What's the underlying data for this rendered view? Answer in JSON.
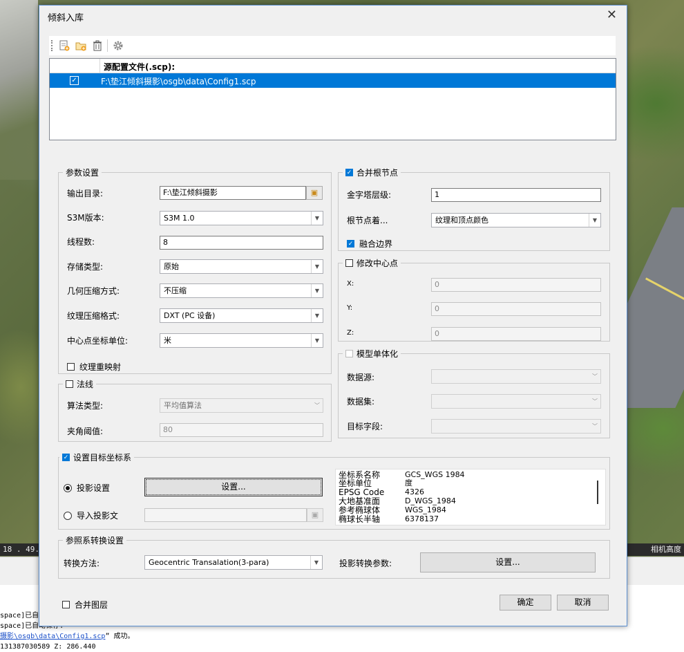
{
  "dialog": {
    "title": "倾斜入库",
    "close_glyph": "✕"
  },
  "toolbar": {
    "icons": [
      "add-file-icon",
      "add-folder-icon",
      "delete-icon",
      "settings-icon"
    ]
  },
  "source_grid": {
    "column_header": "源配置文件(.scp):",
    "rows": [
      {
        "checked": true,
        "path": "F:\\垫江倾斜摄影\\osgb\\data\\Config1.scp"
      }
    ]
  },
  "params": {
    "group_title": "参数设置",
    "output_dir_label": "输出目录:",
    "output_dir_value": "F:\\垫江倾斜摄影",
    "s3m_version_label": "S3M版本:",
    "s3m_version_value": "S3M 1.0",
    "threads_label": "线程数:",
    "threads_value": "8",
    "storage_type_label": "存储类型:",
    "storage_type_value": "原始",
    "geom_compress_label": "几何压缩方式:",
    "geom_compress_value": "不压缩",
    "tex_compress_label": "纹理压缩格式:",
    "tex_compress_value": "DXT (PC 设备)",
    "center_unit_label": "中心点坐标单位:",
    "center_unit_value": "米",
    "tex_remap_label": "纹理重映射"
  },
  "normals": {
    "group_title": "法线",
    "algo_label": "算法类型:",
    "algo_value": "平均值算法",
    "angle_label": "夹角阈值:",
    "angle_value": "80"
  },
  "merge_root": {
    "group_title": "合并根节点",
    "pyramid_label": "金字塔层级:",
    "pyramid_value": "1",
    "root_color_label": "根节点着...",
    "root_color_value": "纹理和顶点颜色",
    "blend_edge_label": "融合边界"
  },
  "center": {
    "group_title": "修改中心点",
    "x_label": "X:",
    "x_value": "0",
    "y_label": "Y:",
    "y_value": "0",
    "z_label": "Z:",
    "z_value": "0"
  },
  "model": {
    "group_title": "模型单体化",
    "datasource_label": "数据源:",
    "dataset_label": "数据集:",
    "field_label": "目标字段:"
  },
  "target_crs": {
    "group_title": "设置目标坐标系",
    "proj_setting_label": "投影设置",
    "proj_setting_button": "设置...",
    "import_label": "导入投影文",
    "info": [
      {
        "k": "坐标系名称",
        "v": "GCS_WGS 1984"
      },
      {
        "k": "坐标单位",
        "v": "度"
      },
      {
        "k": "EPSG Code",
        "v": "4326"
      },
      {
        "k": "大地基准面",
        "v": "D_WGS_1984"
      },
      {
        "k": "参考椭球体",
        "v": "WGS_1984"
      },
      {
        "k": "椭球长半轴",
        "v": "6378137"
      }
    ]
  },
  "ref_transform": {
    "group_title": "参照系转换设置",
    "method_label": "转换方法:",
    "method_value": "Geocentric Transalation(3-para)",
    "param_label": "投影转换参数:",
    "param_button": "设置..."
  },
  "footer": {
    "merge_layers_label": "合并图层",
    "ok": "确定",
    "cancel": "取消"
  },
  "background": {
    "status_left": "18  . 49.",
    "status_right": "相机高度",
    "console_line1": "space]已自",
    "console_line2": "space]已自动保存.",
    "console_link": "摄影\\osgb\\data\\Config1.scp",
    "console_suffix": "” 成功。",
    "console_line4": "131387030589 Z: 286.440"
  },
  "colors": {
    "selection": "#0078d7",
    "dialog_border": "#5b8fd1"
  }
}
